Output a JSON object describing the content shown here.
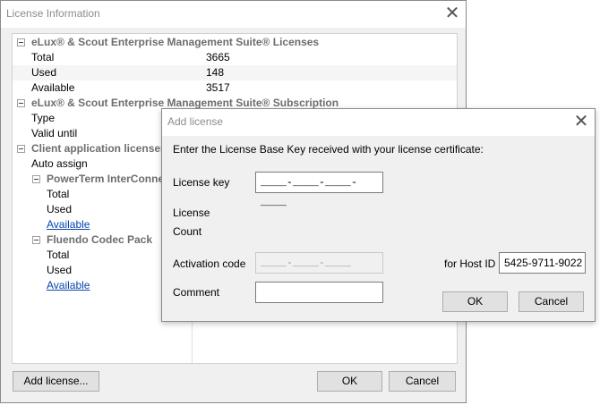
{
  "main": {
    "title": "License Information",
    "groups": {
      "licenses": {
        "label": "eLux® & Scout Enterprise Management Suite® Licenses",
        "rows": [
          {
            "key": "Total",
            "value": "3665"
          },
          {
            "key": "Used",
            "value": "148"
          },
          {
            "key": "Available",
            "value": "3517"
          }
        ]
      },
      "subscription": {
        "label": "eLux® & Scout Enterprise Management Suite® Subscription",
        "rows": [
          {
            "key": "Type",
            "value": ""
          },
          {
            "key": "Valid until",
            "value": ""
          }
        ]
      },
      "client_apps": {
        "label": "Client application licenses",
        "auto_assign": "Auto assign",
        "sub": [
          {
            "label": "PowerTerm InterConnect",
            "rows": [
              "Total",
              "Used",
              "Available"
            ]
          },
          {
            "label": "Fluendo Codec Pack",
            "rows": [
              "Total",
              "Used",
              "Available"
            ]
          }
        ]
      }
    },
    "buttons": {
      "add": "Add license...",
      "ok": "OK",
      "cancel": "Cancel"
    }
  },
  "dialog": {
    "title": "Add license",
    "instruction": "Enter the License Base Key received with your license certificate:",
    "license_key_label": "License key",
    "license_key_value": "____-____-____-____",
    "license_label": "License",
    "count_label": "Count",
    "activation_label": "Activation code",
    "activation_value": "____-____-____",
    "host_label": "for Host ID",
    "host_value": "5425-9711-9022",
    "comment_label": "Comment",
    "comment_value": "",
    "ok": "OK",
    "cancel": "Cancel"
  }
}
